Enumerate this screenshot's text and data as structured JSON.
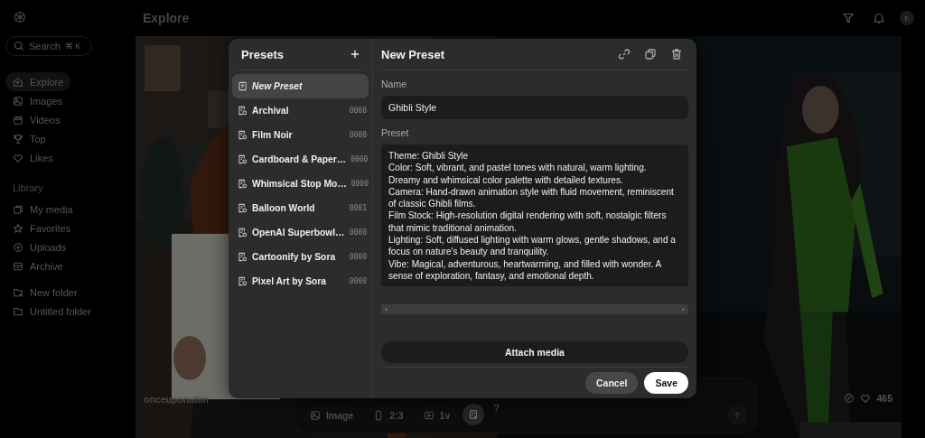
{
  "header": {
    "title": "Explore",
    "avatar": "E"
  },
  "sidebar": {
    "search": {
      "placeholder": "Search",
      "shortcut": "⌘ K"
    },
    "nav": [
      {
        "label": "Explore",
        "selected": true
      },
      {
        "label": "Images",
        "selected": false
      },
      {
        "label": "Videos",
        "selected": false
      },
      {
        "label": "Top",
        "selected": false
      },
      {
        "label": "Likes",
        "selected": false
      }
    ],
    "library_heading": "Library",
    "library": [
      {
        "label": "My media",
        "selected": false
      },
      {
        "label": "Favorites",
        "selected": false
      },
      {
        "label": "Uploads",
        "selected": false
      },
      {
        "label": "Archive",
        "selected": false
      }
    ],
    "folders": [
      {
        "label": "New folder",
        "kind": "new"
      },
      {
        "label": "Untitled folder",
        "kind": "folder"
      }
    ]
  },
  "gallery": {
    "author": "onceuponatim",
    "likes": "465"
  },
  "composer": {
    "options": [
      {
        "label": "Image"
      },
      {
        "label": "2:3"
      },
      {
        "label": "1v"
      }
    ],
    "preset_active": true,
    "help": "?"
  },
  "presets_dialog": {
    "title": "Presets",
    "items": [
      {
        "name": "New Preset",
        "kind": "draft",
        "selected": true
      },
      {
        "name": "Archival",
        "count": "0000",
        "kind": "saved",
        "selected": false
      },
      {
        "name": "Film Noir",
        "count": "0000",
        "kind": "saved",
        "selected": false
      },
      {
        "name": "Cardboard & Paper…",
        "count": "0000",
        "kind": "saved",
        "selected": false
      },
      {
        "name": "Whimsical Stop Mo…",
        "count": "0000",
        "kind": "saved",
        "selected": false
      },
      {
        "name": "Balloon World",
        "count": "0001",
        "kind": "saved",
        "selected": false
      },
      {
        "name": "OpenAI Superbowl…",
        "count": "0000",
        "kind": "saved",
        "selected": false
      },
      {
        "name": "Cartoonify by Sora",
        "count": "0000",
        "kind": "saved",
        "selected": false
      },
      {
        "name": "Pixel Art by Sora",
        "count": "0000",
        "kind": "saved",
        "selected": false
      }
    ],
    "editor": {
      "title": "New Preset",
      "name_label": "Name",
      "name_value": "Ghibli Style",
      "preset_label": "Preset",
      "preset_value": "Theme: Ghibli Style\nColor: Soft, vibrant, and pastel tones with natural, warm lighting.\nDreamy and whimsical color palette with detailed textures.\nCamera: Hand-drawn animation style with fluid movement, reminiscent of classic Ghibli films.\nFilm Stock: High-resolution digital rendering with soft, nostalgic filters that mimic traditional animation.\nLighting: Soft, diffused lighting with warm glows, gentle shadows, and a focus on nature's beauty and tranquility.\nVibe: Magical, adventurous, heartwarming, and filled with wonder. A sense of exploration, fantasy, and emotional depth.",
      "attach": "Attach media",
      "cancel": "Cancel",
      "save": "Save"
    }
  }
}
